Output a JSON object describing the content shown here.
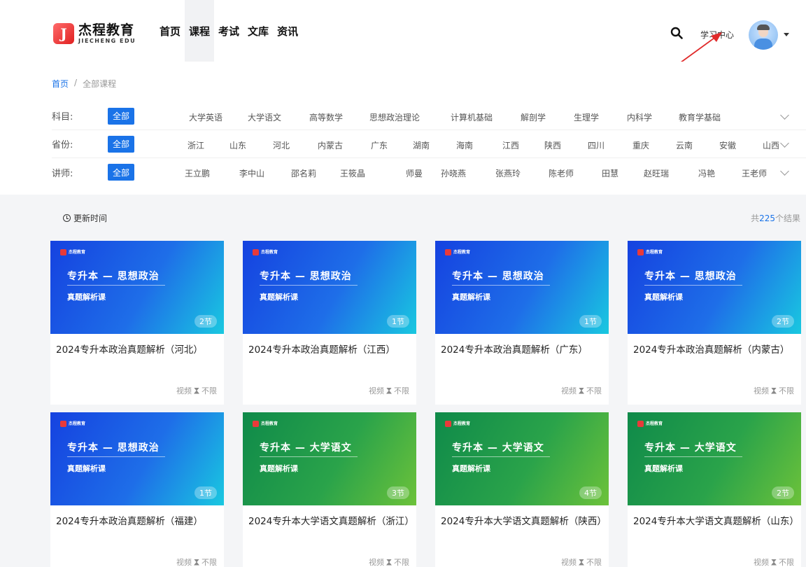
{
  "header": {
    "logo_cn": "杰程教育",
    "logo_en": "JIECHENG EDU",
    "nav": [
      "首页",
      "课程",
      "考试",
      "文库",
      "资讯"
    ],
    "active_nav": "课程",
    "study_center": "学习中心"
  },
  "breadcrumb": {
    "home": "首页",
    "sep": "/",
    "current": "全部课程"
  },
  "filters": {
    "all_label": "全部",
    "subject": {
      "label": "科目:",
      "options": [
        "大学英语",
        "大学语文",
        "高等数学",
        "思想政治理论",
        "计算机基础",
        "解剖学",
        "生理学",
        "内科学",
        "教育学基础"
      ]
    },
    "province": {
      "label": "省份:",
      "options": [
        "浙江",
        "山东",
        "河北",
        "内蒙古",
        "广东",
        "湖南",
        "海南",
        "江西",
        "陕西",
        "四川",
        "重庆",
        "云南",
        "安徽",
        "山西"
      ]
    },
    "teacher": {
      "label": "讲师:",
      "options": [
        "王立鹏",
        "李中山",
        "邵名莉",
        "王筱晶",
        "师曼",
        "孙晓燕",
        "张燕玲",
        "陈老师",
        "田慧",
        "赵旺瑞",
        "冯艳",
        "王老师"
      ]
    }
  },
  "results": {
    "sort_label": "更新时间",
    "total_prefix": "共",
    "total_count": "225",
    "total_suffix": "个结果"
  },
  "cards": [
    {
      "thumb_title": "专升本 — 思想政治",
      "thumb_sub": "真题解析课",
      "badge": "2节",
      "title": "2024专升本政治真题解析（河北）",
      "meta_type": "视频",
      "meta_limit": "不限",
      "theme": "blue"
    },
    {
      "thumb_title": "专升本 — 思想政治",
      "thumb_sub": "真题解析课",
      "badge": "1节",
      "title": "2024专升本政治真题解析（江西）",
      "meta_type": "视频",
      "meta_limit": "不限",
      "theme": "blue"
    },
    {
      "thumb_title": "专升本 — 思想政治",
      "thumb_sub": "真题解析课",
      "badge": "1节",
      "title": "2024专升本政治真题解析（广东）",
      "meta_type": "视频",
      "meta_limit": "不限",
      "theme": "blue"
    },
    {
      "thumb_title": "专升本 — 思想政治",
      "thumb_sub": "真题解析课",
      "badge": "2节",
      "title": "2024专升本政治真题解析（内蒙古）",
      "meta_type": "视频",
      "meta_limit": "不限",
      "theme": "blue"
    },
    {
      "thumb_title": "专升本 — 思想政治",
      "thumb_sub": "真题解析课",
      "badge": "1节",
      "title": "2024专升本政治真题解析（福建）",
      "meta_type": "视频",
      "meta_limit": "不限",
      "theme": "blue"
    },
    {
      "thumb_title": "专升本 — 大学语文",
      "thumb_sub": "真题解析课",
      "badge": "3节",
      "title": "2024专升本大学语文真题解析（浙江）",
      "meta_type": "视频",
      "meta_limit": "不限",
      "theme": "green"
    },
    {
      "thumb_title": "专升本 — 大学语文",
      "thumb_sub": "真题解析课",
      "badge": "4节",
      "title": "2024专升本大学语文真题解析（陕西）",
      "meta_type": "视频",
      "meta_limit": "不限",
      "theme": "green"
    },
    {
      "thumb_title": "专升本 — 大学语文",
      "thumb_sub": "真题解析课",
      "badge": "2节",
      "title": "2024专升本大学语文真题解析（山东）",
      "meta_type": "视频",
      "meta_limit": "不限",
      "theme": "green"
    }
  ],
  "thumb_logo": "杰程教育"
}
